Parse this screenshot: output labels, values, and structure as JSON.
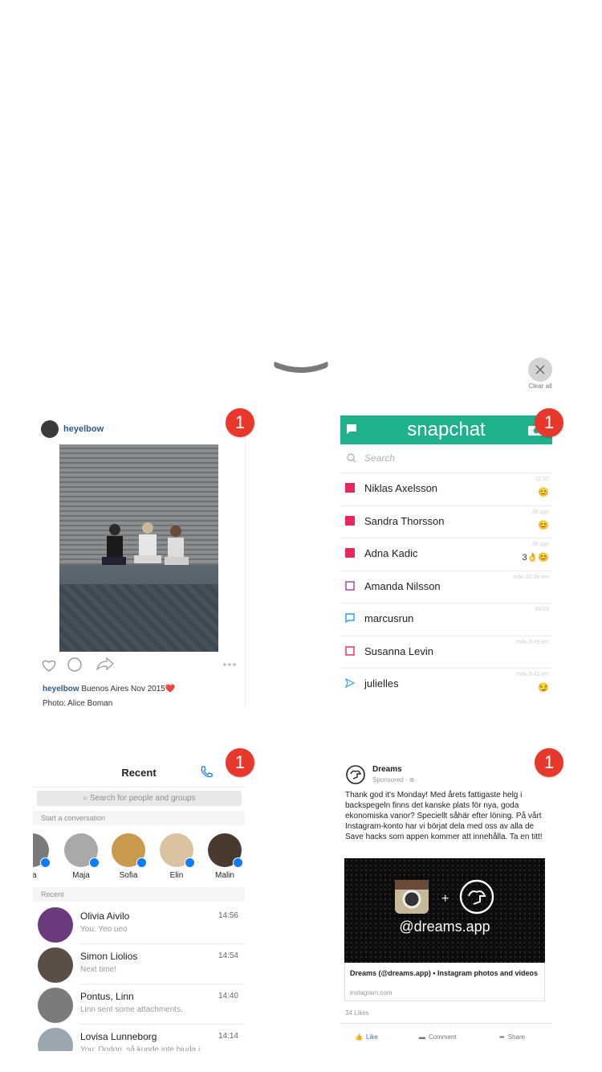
{
  "clear_all": {
    "label": "Clear all"
  },
  "badges": {
    "instagram": "1",
    "snapchat": "1",
    "messenger": "1",
    "facebook": "1"
  },
  "instagram": {
    "username": "heyelbow",
    "caption_user": "heyelbow",
    "caption_text": " Buenos Aires Nov 2015❤️",
    "credit": "Photo: Alice Boman"
  },
  "snapchat": {
    "title": "snapchat",
    "search_placeholder": "Search",
    "rows": [
      {
        "name": "Niklas Axelsson",
        "time": "11:52",
        "emoji": "😊",
        "icon": "filled-square",
        "color": "#e8275a"
      },
      {
        "name": "Sandra Thorsson",
        "time": "3h ago",
        "emoji": "😊",
        "icon": "filled-square",
        "color": "#e8275a"
      },
      {
        "name": "Adna Kadic",
        "time": "3h ago",
        "emoji": "3👌😊",
        "icon": "filled-square",
        "color": "#e8275a"
      },
      {
        "name": "Amanda Nilsson",
        "time": "mån 10:38 em",
        "emoji": "",
        "icon": "outline-square",
        "color": "#9b3fb5"
      },
      {
        "name": "marcusrun",
        "time": "00:03",
        "emoji": "",
        "icon": "chat-bubble",
        "color": "#2f9fe8"
      },
      {
        "name": "Susanna Levin",
        "time": "mån 9:49 em",
        "emoji": "",
        "icon": "outline-square",
        "color": "#e8275a"
      },
      {
        "name": "julielles",
        "time": "mån 9:41 em",
        "emoji": "😏",
        "icon": "send-arrow",
        "color": "#2f9fe8"
      }
    ]
  },
  "messenger": {
    "title": "Recent",
    "search_placeholder": "Search for people and groups",
    "start_label": "Start a conversation",
    "recent_label": "Recent",
    "people": [
      {
        "name": "na",
        "color": "#7a7a7a"
      },
      {
        "name": "Maja",
        "color": "#a9a9a9"
      },
      {
        "name": "Sofia",
        "color": "#c79a4e"
      },
      {
        "name": "Elin",
        "color": "#d9c3a0"
      },
      {
        "name": "Malin",
        "color": "#4a3a2e"
      }
    ],
    "conversations": [
      {
        "name": "Olivia Aivilo",
        "message": "You: Yeo ueo",
        "time": "14:56",
        "color": "#6b3a7d"
      },
      {
        "name": "Simon Liolios",
        "message": "Next time!",
        "time": "14:54",
        "color": "#5a4e45"
      },
      {
        "name": "Pontus, Linn",
        "message": "Linn sent some attachments.",
        "time": "14:40",
        "color": "#7b7b7b"
      },
      {
        "name": "Lovisa Lunneborg",
        "message": "You: Dodon, så kunde inte bjuda i",
        "time": "14:14",
        "color": "#9aa7b0"
      }
    ]
  },
  "facebook": {
    "page_name": "Dreams",
    "sponsored": "Sponsored · ⊕",
    "body": "Thank god it's Monday! Med årets fattigaste helg i backspegeln finns det kanske plats för nya, goda ekonomiska vanor? Speciellt såhär efter löning. På vårt Instagram-konto har vi börjat dela med oss av alla de Save hacks som appen kommer att innehålla. Ta en titt!",
    "handle": "@dreams.app",
    "link_title": "Dreams (@dreams.app) • Instagram photos and videos",
    "link_url": "instagram.com",
    "likes": "34 Likes",
    "like": "Like",
    "comment": "Comment",
    "share": "Share"
  }
}
